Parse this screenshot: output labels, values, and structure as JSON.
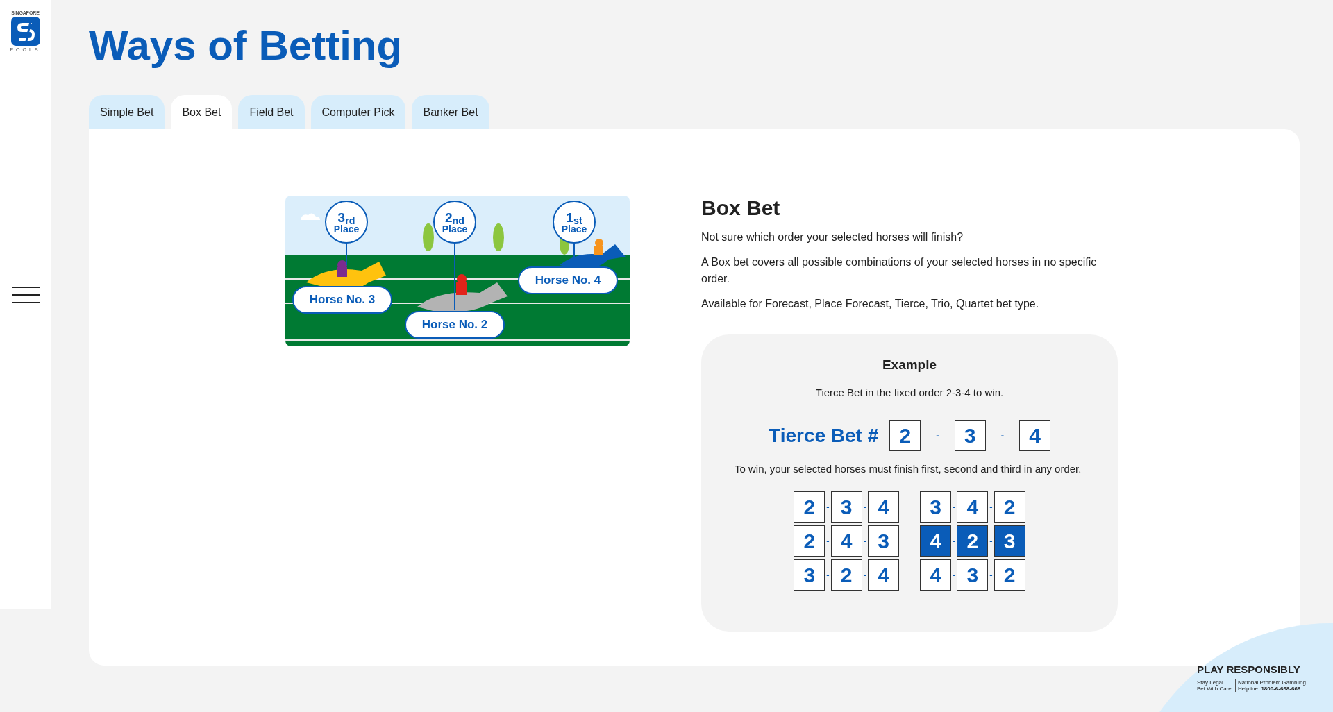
{
  "logo": {
    "top": "SINGAPORE",
    "bottom": "POOLS"
  },
  "page_title": "Ways of Betting",
  "tabs": [
    {
      "label": "Simple Bet",
      "selected": false
    },
    {
      "label": "Box Bet",
      "selected": true
    },
    {
      "label": "Field Bet",
      "selected": false
    },
    {
      "label": "Computer Pick",
      "selected": false
    },
    {
      "label": "Banker Bet",
      "selected": false
    }
  ],
  "illustration": {
    "place_badges": [
      {
        "ordinal": "3$_{rd}$",
        "label": "Place"
      },
      {
        "ordinal": "2$_{nd}$",
        "label": "Place"
      },
      {
        "ordinal": "1$_{st}$",
        "label": "Place"
      }
    ],
    "horse_labels": [
      "Horse No. 3",
      "Horse No. 2",
      "Horse No. 4"
    ]
  },
  "section": {
    "heading": "Box Bet",
    "paragraphs": [
      "Not sure which order your selected horses will finish?",
      "A Box bet covers all possible combinations of your selected horses in no specific order.",
      "Available for Forecast, Place Forecast, Tierce, Trio, Quartet bet type."
    ]
  },
  "example": {
    "heading": "Example",
    "intro": "Tierce Bet in the fixed order 2-3-4 to win.",
    "bet": {
      "label": "Tierce Bet #",
      "parts": [
        "2",
        "-",
        "3",
        "-",
        "4"
      ]
    },
    "explanation": "To win, your selected horses must finish first, second and third in any order.",
    "combinations": [
      {
        "parts": [
          "2",
          "-",
          "3",
          "-",
          "4"
        ],
        "selected": false
      },
      {
        "parts": [
          "3",
          "-",
          "4",
          "-",
          "2"
        ],
        "selected": false
      },
      {
        "parts": [
          "2",
          "-",
          "4",
          "-",
          "3"
        ],
        "selected": false
      },
      {
        "parts": [
          "4",
          "-",
          "2",
          "-",
          "3"
        ],
        "selected": true
      },
      {
        "parts": [
          "3",
          "-",
          "2",
          "-",
          "4"
        ],
        "selected": false
      },
      {
        "parts": [
          "4",
          "-",
          "3",
          "-",
          "2"
        ],
        "selected": false
      }
    ]
  },
  "footer_badge": {
    "title": "PLAY RESPONSIBLY",
    "left_lines": [
      "Stay Legal.",
      "Bet With Care."
    ],
    "right_lines": [
      "National Problem Gambling",
      "Helpline: **1800-6-668-668**"
    ]
  }
}
